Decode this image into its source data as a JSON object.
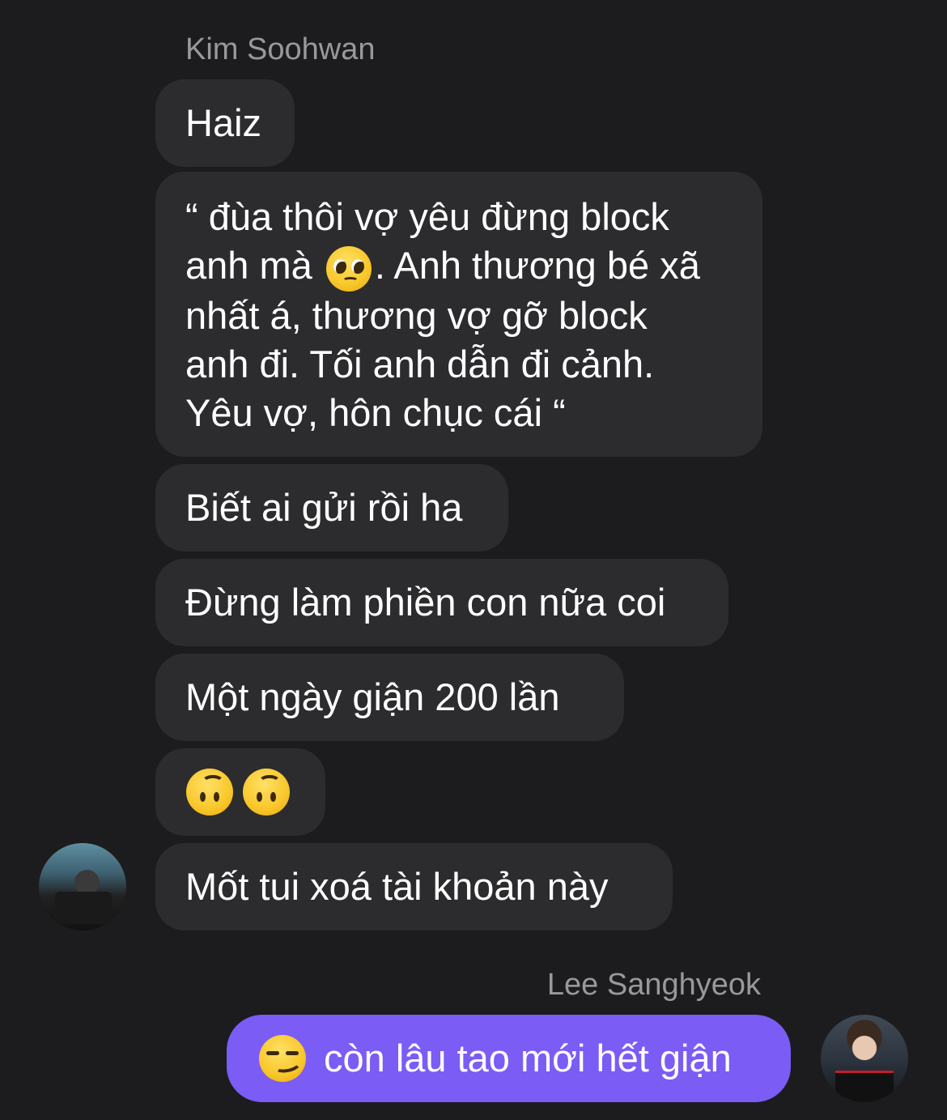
{
  "conversation": {
    "incoming": {
      "sender_name": "Kim Soohwan",
      "avatar_icon": "avatar-photo",
      "messages": [
        {
          "text": "Haiz"
        },
        {
          "lines": [
            "“ đùa thôi vợ yêu đừng block",
            "anh mà",
            ". Anh thương bé xã",
            "nhất á, thương vợ gỡ block",
            "anh đi. Tối anh dẫn đi cảnh.",
            "Yêu vợ, hôn chục cái “"
          ],
          "emoji": "pleading-face-icon"
        },
        {
          "text": "Biết ai gửi rồi ha"
        },
        {
          "text": "Đừng làm phiền con nữa coi"
        },
        {
          "text": "Một ngày giận 200 lần"
        },
        {
          "emojis": [
            "upside-down-face-icon",
            "upside-down-face-icon"
          ]
        },
        {
          "text": "Mốt tui xoá tài khoản này"
        }
      ]
    },
    "outgoing": {
      "sender_name": "Lee Sanghyeok",
      "avatar_icon": "avatar-photo",
      "message": {
        "emoji": "smirking-face-icon",
        "text": "còn lâu tao mới hết giận"
      }
    }
  },
  "colors": {
    "background": "#1c1c1e",
    "incoming_bubble": "#2c2c2e",
    "outgoing_bubble": "#7b5cf5",
    "sender_name": "#98989d",
    "text": "#ffffff"
  }
}
